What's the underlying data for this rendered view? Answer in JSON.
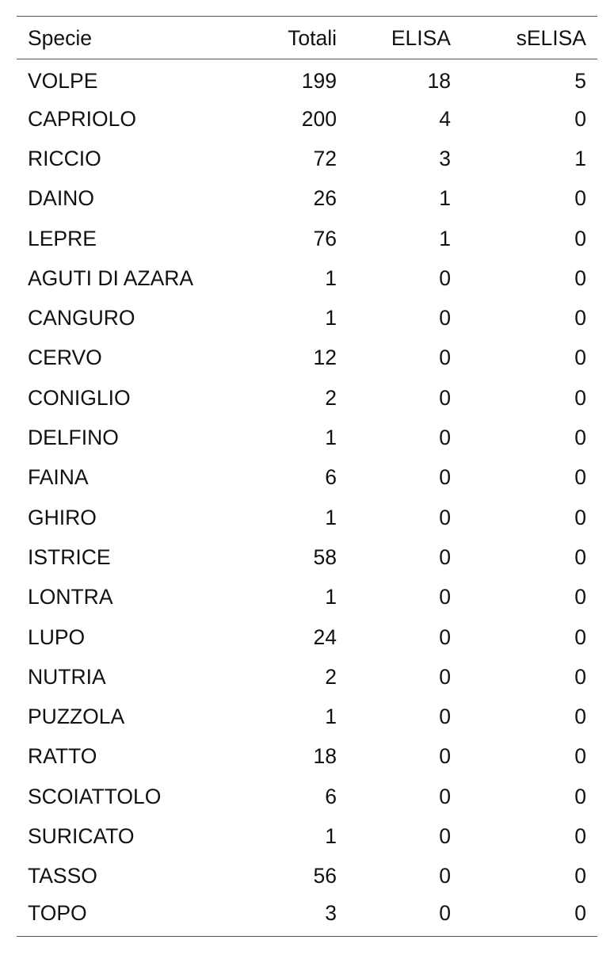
{
  "table": {
    "headers": {
      "specie": "Specie",
      "totali": "Totali",
      "elisa": "ELISA",
      "selisa": "sELISA"
    },
    "rows": [
      {
        "specie": "VOLPE",
        "totali": "199",
        "elisa": "18",
        "selisa": "5"
      },
      {
        "specie": "CAPRIOLO",
        "totali": "200",
        "elisa": "4",
        "selisa": "0"
      },
      {
        "specie": "RICCIO",
        "totali": "72",
        "elisa": "3",
        "selisa": "1"
      },
      {
        "specie": "DAINO",
        "totali": "26",
        "elisa": "1",
        "selisa": "0"
      },
      {
        "specie": "LEPRE",
        "totali": "76",
        "elisa": "1",
        "selisa": "0"
      },
      {
        "specie": "AGUTI DI AZARA",
        "totali": "1",
        "elisa": "0",
        "selisa": "0"
      },
      {
        "specie": "CANGURO",
        "totali": "1",
        "elisa": "0",
        "selisa": "0"
      },
      {
        "specie": "CERVO",
        "totali": "12",
        "elisa": "0",
        "selisa": "0"
      },
      {
        "specie": "CONIGLIO",
        "totali": "2",
        "elisa": "0",
        "selisa": "0"
      },
      {
        "specie": "DELFINO",
        "totali": "1",
        "elisa": "0",
        "selisa": "0"
      },
      {
        "specie": "FAINA",
        "totali": "6",
        "elisa": "0",
        "selisa": "0"
      },
      {
        "specie": "GHIRO",
        "totali": "1",
        "elisa": "0",
        "selisa": "0"
      },
      {
        "specie": "ISTRICE",
        "totali": "58",
        "elisa": "0",
        "selisa": "0"
      },
      {
        "specie": "LONTRA",
        "totali": "1",
        "elisa": "0",
        "selisa": "0"
      },
      {
        "specie": "LUPO",
        "totali": "24",
        "elisa": "0",
        "selisa": "0"
      },
      {
        "specie": "NUTRIA",
        "totali": "2",
        "elisa": "0",
        "selisa": "0"
      },
      {
        "specie": "PUZZOLA",
        "totali": "1",
        "elisa": "0",
        "selisa": "0"
      },
      {
        "specie": "RATTO",
        "totali": "18",
        "elisa": "0",
        "selisa": "0"
      },
      {
        "specie": "SCOIATTOLO",
        "totali": "6",
        "elisa": "0",
        "selisa": "0"
      },
      {
        "specie": "SURICATO",
        "totali": "1",
        "elisa": "0",
        "selisa": "0"
      },
      {
        "specie": "TASSO",
        "totali": "56",
        "elisa": "0",
        "selisa": "0"
      },
      {
        "specie": "TOPO",
        "totali": "3",
        "elisa": "0",
        "selisa": "0"
      }
    ]
  }
}
